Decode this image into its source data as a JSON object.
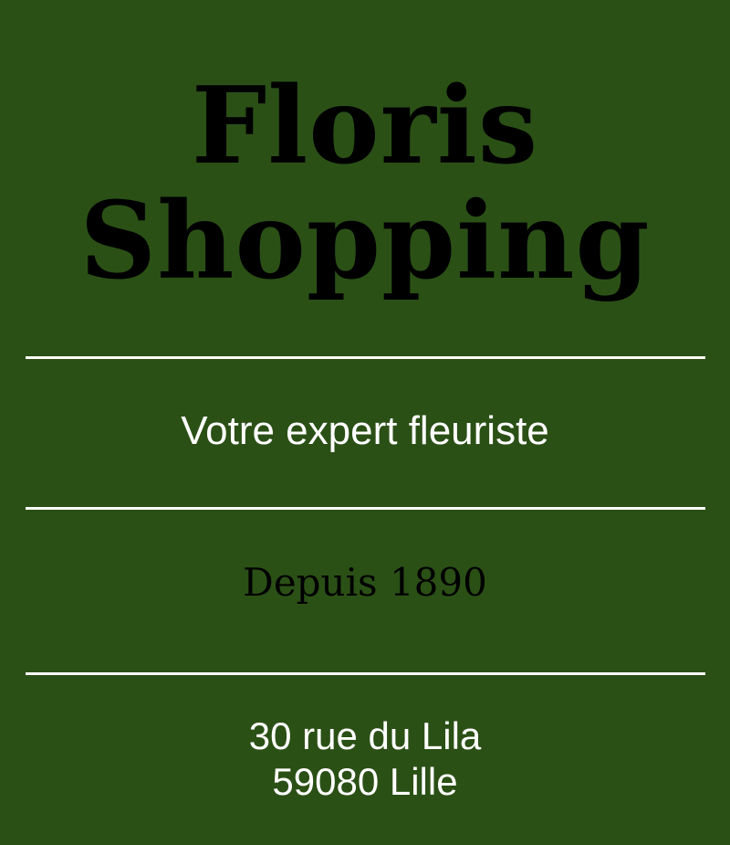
{
  "brand": {
    "title_line_1": "Floris",
    "title_line_2": "Shopping"
  },
  "tagline": "Votre expert fleuriste",
  "since": "Depuis 1890",
  "address": {
    "street": "30 rue du Lila",
    "city": "59080 Lille"
  },
  "colors": {
    "background": "#2b5016",
    "title_text": "#000000",
    "light_text": "#ffffff",
    "rules": "#ffffff"
  }
}
